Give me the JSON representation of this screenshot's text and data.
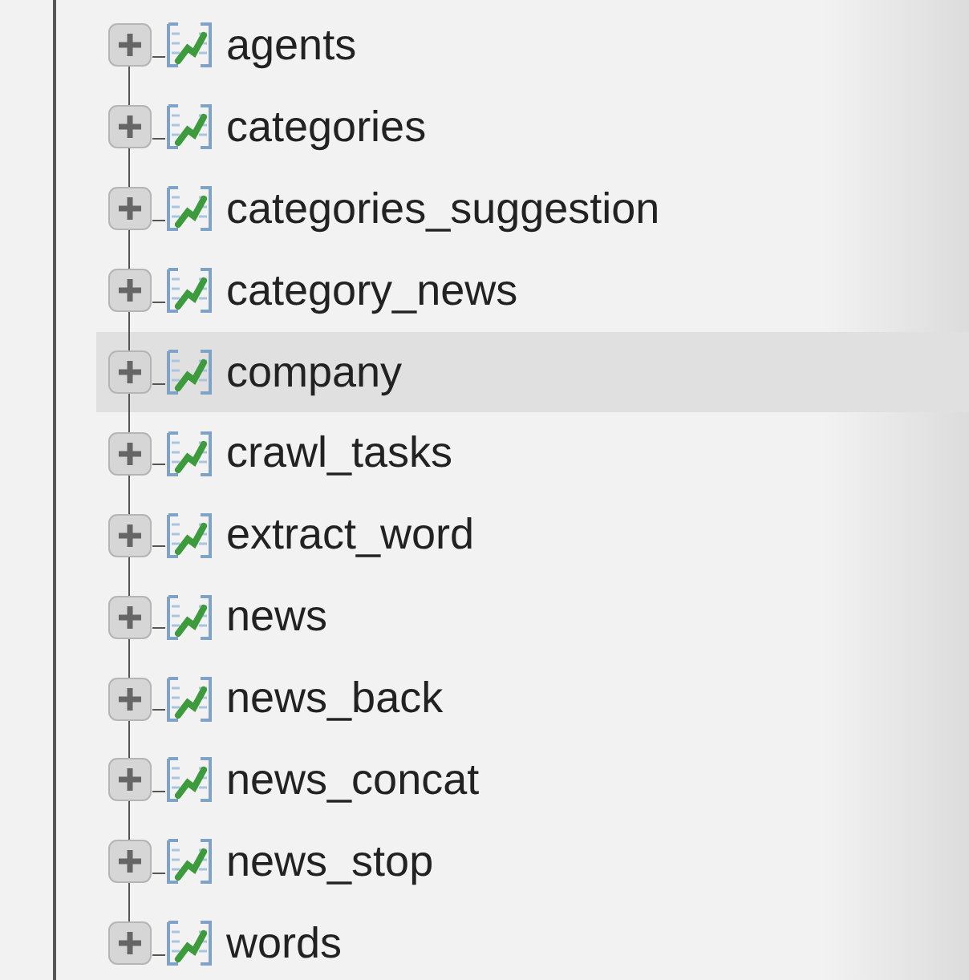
{
  "tree": {
    "items": [
      {
        "label": "agents",
        "selected": false
      },
      {
        "label": "categories",
        "selected": false
      },
      {
        "label": "categories_suggestion",
        "selected": false
      },
      {
        "label": "category_news",
        "selected": false
      },
      {
        "label": "company",
        "selected": true
      },
      {
        "label": "crawl_tasks",
        "selected": false
      },
      {
        "label": "extract_word",
        "selected": false
      },
      {
        "label": "news",
        "selected": false
      },
      {
        "label": "news_back",
        "selected": false
      },
      {
        "label": "news_concat",
        "selected": false
      },
      {
        "label": "news_stop",
        "selected": false
      },
      {
        "label": "words",
        "selected": false
      }
    ]
  }
}
